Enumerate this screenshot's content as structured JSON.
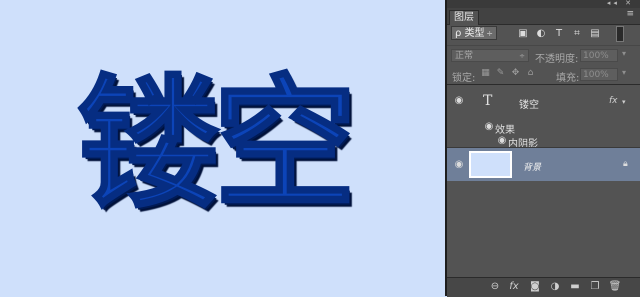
{
  "canvas": {
    "text": "镂空",
    "background_color": "#cfe0fb",
    "text_color": "#0c44b8"
  },
  "panel": {
    "tab_label": "图层",
    "strip_icons": "◂◂ ✕",
    "menu_icon": "≡",
    "filter": {
      "label": "ρ 类型",
      "arrow": "÷"
    },
    "blend_mode": "正常",
    "opacity": {
      "label": "不透明度:",
      "value": "100%"
    },
    "lock_label": "锁定:",
    "fill": {
      "label": "填充:",
      "value": "100%"
    },
    "layers": [
      {
        "name": "镂空",
        "type": "text",
        "thumb": "T",
        "fx": "fx"
      },
      {
        "name": "背景",
        "type": "background",
        "selected": true
      }
    ],
    "effects_label": "效果",
    "inner_shadow_label": "内阴影",
    "bottom_icons": [
      "link-layers-icon",
      "fx-icon",
      "mask-icon",
      "adjustment-icon",
      "folder-icon",
      "new-layer-icon",
      "trash-icon"
    ]
  }
}
